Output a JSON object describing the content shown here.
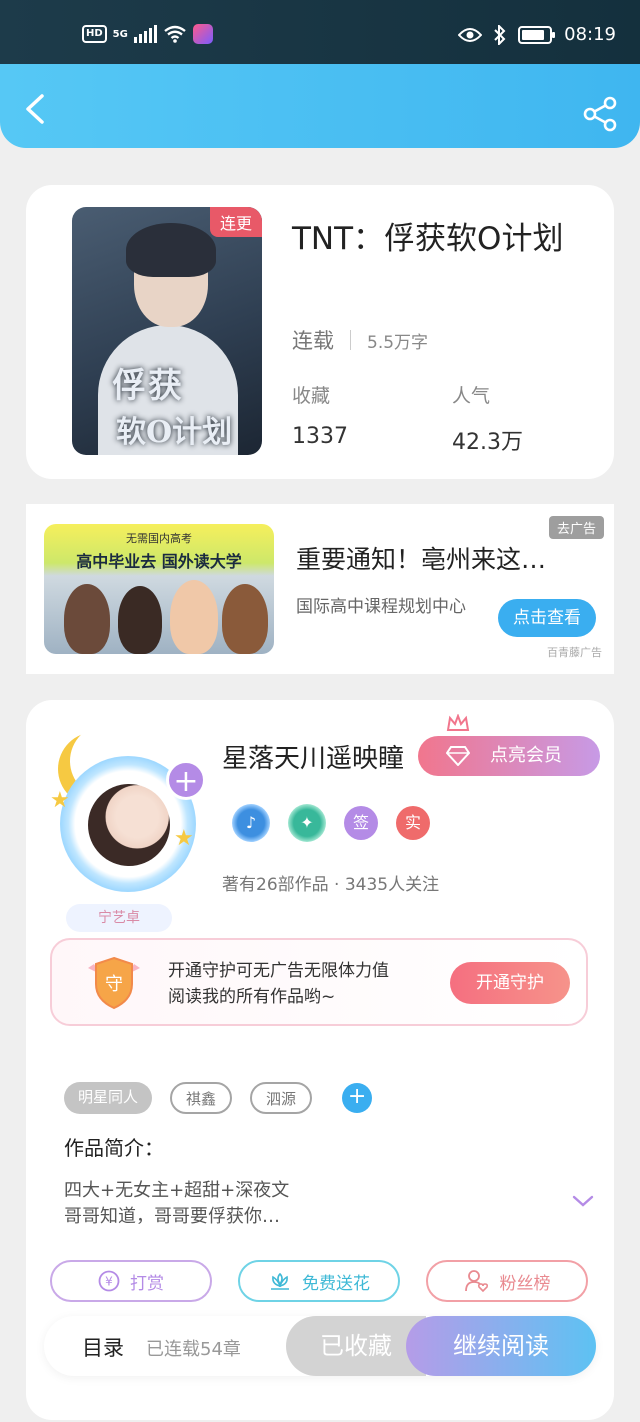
{
  "status_bar": {
    "network": "HD",
    "signal": "5G",
    "time": "08:19"
  },
  "colors": {
    "header": "#46bcf2",
    "accent_blue": "#3aaef0",
    "accent_purple": "#b48be6",
    "accent_pink": "#f56f80"
  },
  "header": {
    "back_icon": "chevron-left-icon",
    "share_icon": "share-icon"
  },
  "book": {
    "cover_badge": "连更",
    "cover_title_1": "俘获",
    "cover_title_2": "软O计划",
    "title": "TNT：俘获软O计划",
    "status": "连载",
    "word_count": "5.5万字",
    "stats": [
      {
        "label": "收藏",
        "value": "1337"
      },
      {
        "label": "人气",
        "value": "42.3万"
      }
    ]
  },
  "ad": {
    "image_line1": "无需国内高考",
    "image_line2": "高中毕业去 国外读大学",
    "tag": "去广告",
    "title": "重要通知！亳州来这…",
    "subtitle": "国际高中课程规划中心",
    "button": "点击查看",
    "source": "百青藤广告"
  },
  "author": {
    "plate_name": "宁艺卓",
    "name": "星落天川遥映瞳",
    "vip_button": "点亮会员",
    "badges": [
      "签",
      "实"
    ],
    "stats": "著有26部作品 · 3435人关注",
    "guard_icon_text": "守",
    "guard_text_1": "开通守护可无广告无限体力值",
    "guard_text_2": "阅读我的所有作品哟~",
    "guard_button": "开通守护"
  },
  "tags": [
    "明星同人",
    "祺鑫",
    "泗源"
  ],
  "intro": {
    "title": "作品简介：",
    "line1": "四大+无女主+超甜+深夜文",
    "line2": "哥哥知道，哥哥要俘获你…"
  },
  "actions": {
    "reward": "打赏",
    "flower": "免费送花",
    "fans": "粉丝榜"
  },
  "bottom": {
    "toc": "目录",
    "chapters": "已连载54章",
    "favorited": "已收藏",
    "continue": "继续阅读"
  }
}
